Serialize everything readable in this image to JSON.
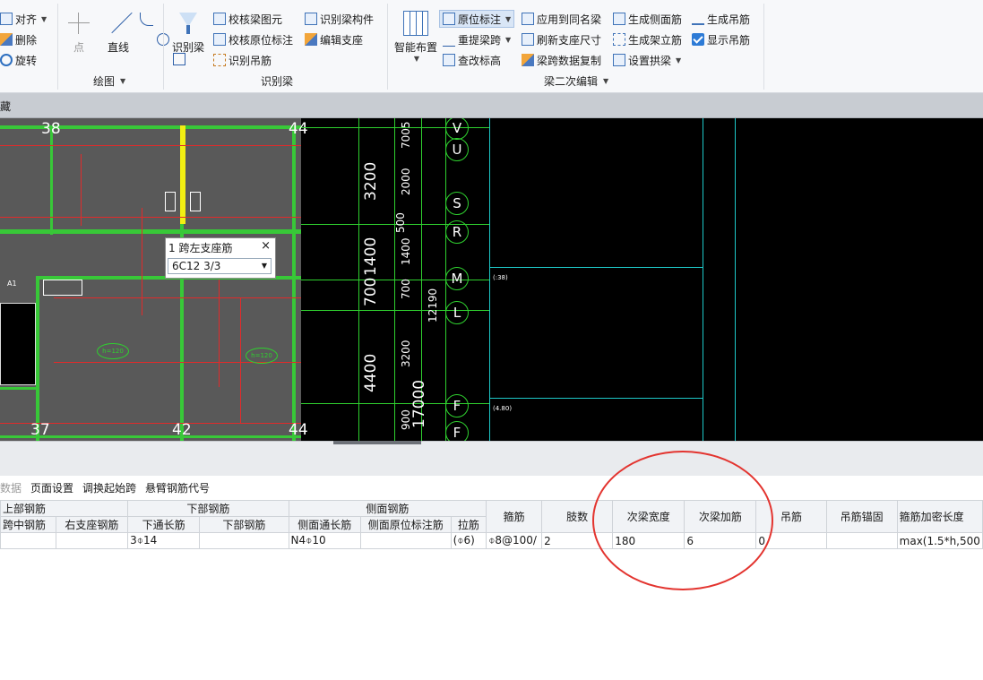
{
  "ribbon": {
    "modify": {
      "align": "对齐",
      "delete": "删除",
      "rotate": "旋转"
    },
    "draw": {
      "point": "点",
      "line": "直线",
      "group_label": "绘图"
    },
    "identify": {
      "identify_beam": "识别梁",
      "check_beam_elements": "校核梁图元",
      "check_in_situ_marks": "校核原位标注",
      "identify_hanger": "识别吊筋",
      "identify_beam_members": "识别梁构件",
      "edit_support": "编辑支座",
      "group_label": "识别梁"
    },
    "secondary_edit": {
      "smart_layout": "智能布置",
      "in_situ_mark": "原位标注",
      "relift_span": "重提梁跨",
      "check_elevation": "查改标高",
      "apply_same_name": "应用到同名梁",
      "refresh_support": "刷新支座尺寸",
      "span_data_copy": "梁跨数据复制",
      "gen_side_bars": "生成侧面筋",
      "gen_erection_bars": "生成架立筋",
      "set_arch": "设置拱梁",
      "gen_hanger": "生成吊筋",
      "show_hanger": "显示吊筋",
      "group_label": "梁二次编辑"
    }
  },
  "tabbar": {
    "label": "藏"
  },
  "canvas": {
    "axis_numbers_top": [
      "38",
      "44"
    ],
    "axis_numbers_bottom": [
      "37",
      "42",
      "44"
    ],
    "plan_marks": [
      "A1",
      "h=120",
      "h=120"
    ],
    "dimensions_large": [
      "3200",
      "1400",
      "700",
      "4400",
      "17000"
    ],
    "dimensions_small": [
      "7005",
      "2000",
      "500",
      "1400",
      "700",
      "3200",
      "900",
      "12190"
    ],
    "axis_letters": [
      "V",
      "U",
      "S",
      "R",
      "M",
      "L",
      "F",
      "F"
    ],
    "right_marks": [
      "(:38)",
      "(4.80)"
    ]
  },
  "popup": {
    "title": "1 跨左支座筋",
    "close": "×",
    "value": "6C12 3/3"
  },
  "panel": {
    "tools": [
      "数据",
      "页面设置",
      "调换起始跨",
      "悬臂钢筋代号"
    ],
    "headers_top": [
      "上部钢筋",
      "下部钢筋",
      "侧面钢筋"
    ],
    "headers_sub": [
      "跨中钢筋",
      "右支座钢筋",
      "下通长筋",
      "下部钢筋",
      "侧面通长筋",
      "侧面原位标注筋",
      "拉筋"
    ],
    "headers_single": [
      "箍筋",
      "肢数",
      "次梁宽度",
      "次梁加筋",
      "吊筋",
      "吊筋锚固",
      "箍筋加密长度"
    ],
    "row": [
      "",
      "",
      "3⌽14",
      "",
      "N4⌽10",
      "",
      "(⌽6)",
      "⌽8@100/",
      "2",
      "180",
      "6",
      "0",
      "",
      "max(1.5*h,500"
    ]
  }
}
